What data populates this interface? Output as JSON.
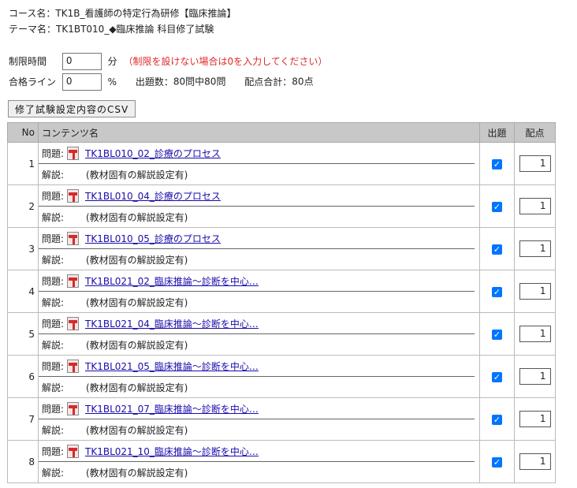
{
  "header": {
    "course_label": "コース名：",
    "course_value": "TK1B_看護師の特定行為研修【臨床推論】",
    "theme_label": "テーマ名：",
    "theme_value": "TK1BT010_◆臨床推論 科目修了試験"
  },
  "settings": {
    "time_limit_label": "制限時間",
    "time_limit_value": "0",
    "time_limit_unit": "分",
    "time_limit_note": "（制限を設けない場合は0を入力してください）",
    "pass_line_label": "合格ライン",
    "pass_line_value": "0",
    "pass_line_unit": "%",
    "question_count_label": "出題数：",
    "question_count_value": "80問中80問",
    "total_points_label": "配点合計：",
    "total_points_value": "80点"
  },
  "csv_button_label": "修了試験設定内容のCSV",
  "table": {
    "headers": {
      "no": "No",
      "content": "コンテンツ名",
      "include": "出題",
      "points": "配点"
    },
    "question_label": "問題:",
    "explanation_label": "解説:",
    "rows": [
      {
        "no": "1",
        "title": "TK1BL010_02_診療のプロセス",
        "explanation": "(教材固有の解説設定有)",
        "checked": true,
        "points": "1"
      },
      {
        "no": "2",
        "title": "TK1BL010_04_診療のプロセス",
        "explanation": "(教材固有の解説設定有)",
        "checked": true,
        "points": "1"
      },
      {
        "no": "3",
        "title": "TK1BL010_05_診療のプロセス",
        "explanation": "(教材固有の解説設定有)",
        "checked": true,
        "points": "1"
      },
      {
        "no": "4",
        "title": "TK1BL021_02_臨床推論～診断を中心…",
        "explanation": "(教材固有の解説設定有)",
        "checked": true,
        "points": "1"
      },
      {
        "no": "5",
        "title": "TK1BL021_04_臨床推論～診断を中心…",
        "explanation": "(教材固有の解説設定有)",
        "checked": true,
        "points": "1"
      },
      {
        "no": "6",
        "title": "TK1BL021_05_臨床推論～診断を中心…",
        "explanation": "(教材固有の解説設定有)",
        "checked": true,
        "points": "1"
      },
      {
        "no": "7",
        "title": "TK1BL021_07_臨床推論～診断を中心…",
        "explanation": "(教材固有の解説設定有)",
        "checked": true,
        "points": "1"
      },
      {
        "no": "8",
        "title": "TK1BL021_10_臨床推論～診断を中心…",
        "explanation": "(教材固有の解説設定有)",
        "checked": true,
        "points": "1"
      }
    ]
  }
}
